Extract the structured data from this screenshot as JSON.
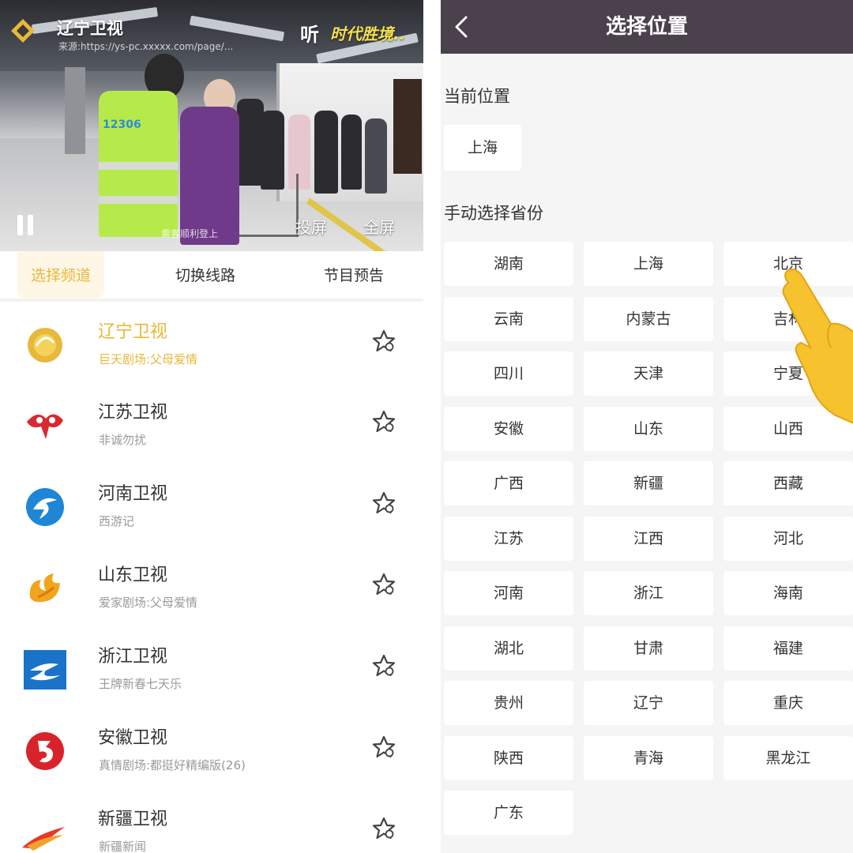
{
  "left": {
    "video": {
      "channel_title": "辽宁卫视",
      "source_text": "来源:https://ys-pc.xxxxx.com/page/...",
      "listen_label": "听",
      "listen_badge": "时代胜境..",
      "vest_text": "12306",
      "caption": "乘客顺利登上",
      "cast_label": "投屏",
      "fullscreen_label": "全屏"
    },
    "tabs": [
      {
        "label": "选择频道",
        "active": true
      },
      {
        "label": "切换线路",
        "active": false
      },
      {
        "label": "节目预告",
        "active": false
      }
    ],
    "channels": [
      {
        "name": "辽宁卫视",
        "program": "巨天剧场:父母爱情",
        "active": true,
        "logo": "liaoning-logo"
      },
      {
        "name": "江苏卫视",
        "program": "非诚勿扰",
        "active": false,
        "logo": "jiangsu-logo"
      },
      {
        "name": "河南卫视",
        "program": "西游记",
        "active": false,
        "logo": "henan-logo"
      },
      {
        "name": "山东卫视",
        "program": "爱家剧场:父母爱情",
        "active": false,
        "logo": "shandong-logo"
      },
      {
        "name": "浙江卫视",
        "program": "王牌新春七天乐",
        "active": false,
        "logo": "zhejiang-logo"
      },
      {
        "name": "安徽卫视",
        "program": "真情剧场:都挺好精编版(26)",
        "active": false,
        "logo": "anhui-logo"
      },
      {
        "name": "新疆卫视",
        "program": "新疆新闻",
        "active": false,
        "logo": "xinjiang-logo"
      }
    ]
  },
  "right": {
    "title": "选择位置",
    "current_label": "当前位置",
    "current_value": "上海",
    "manual_label": "手动选择省份",
    "provinces": [
      "湖南",
      "上海",
      "北京",
      "云南",
      "内蒙古",
      "吉林",
      "四川",
      "天津",
      "宁夏",
      "安徽",
      "山东",
      "山西",
      "广西",
      "新疆",
      "西藏",
      "江苏",
      "江西",
      "河北",
      "河南",
      "浙江",
      "海南",
      "湖北",
      "甘肃",
      "福建",
      "贵州",
      "辽宁",
      "重庆",
      "陕西",
      "青海",
      "黑龙江",
      "广东"
    ]
  },
  "colors": {
    "accent": "#e8b83a",
    "header_bg": "#4b414d",
    "panel_bg": "#f5f5f5"
  }
}
